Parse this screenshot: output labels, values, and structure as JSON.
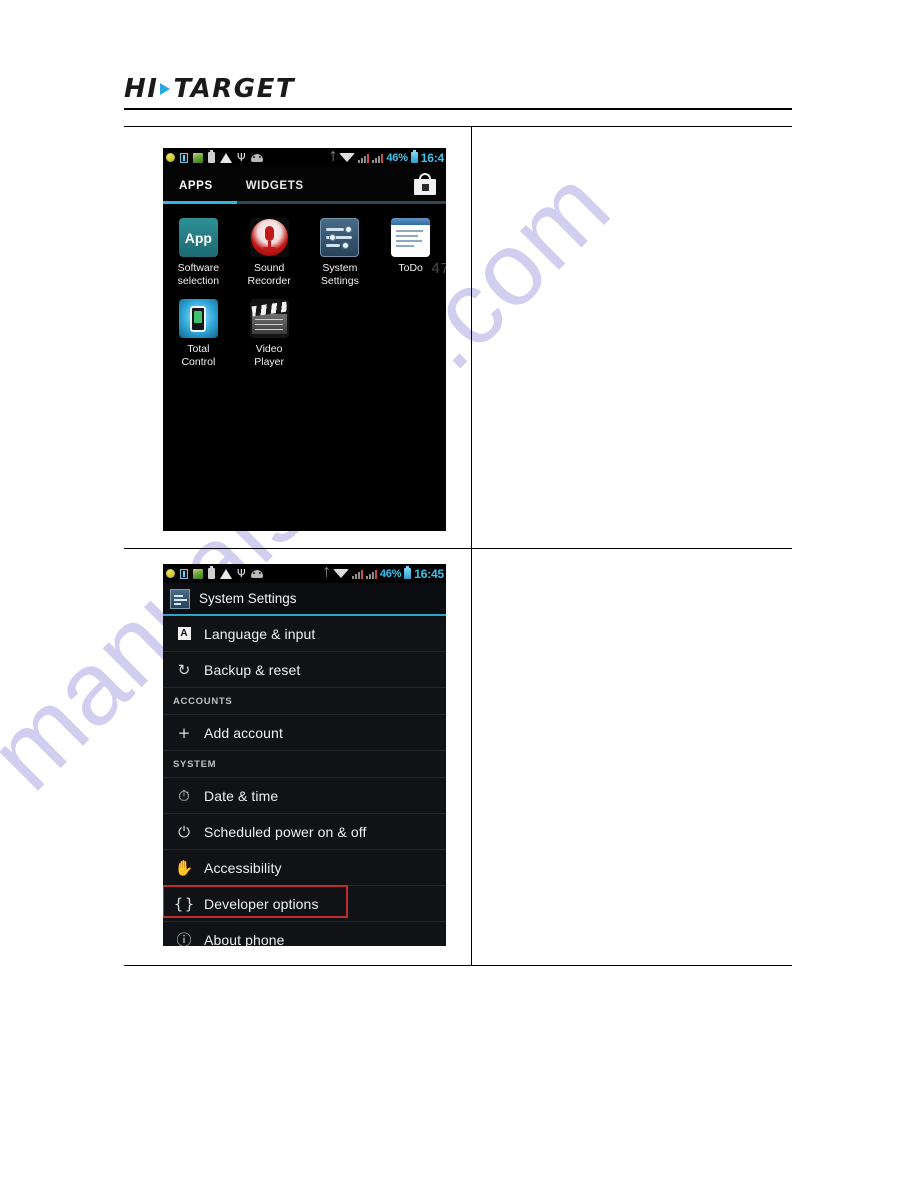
{
  "page": {
    "watermark": "manualshive.com",
    "corner_watermark": "47"
  },
  "header": {
    "logo_part1": "HI",
    "logo_part2": "TARGET",
    "triangle_color": "#2aa8e0"
  },
  "figures": [
    {
      "name": "app-drawer-screenshot",
      "statusbar": {
        "battery_percent": "46%",
        "time": "16:4",
        "icons_left": [
          "sync-icon",
          "sim-card-icon",
          "sd-card-icon",
          "battery-saver-icon",
          "warning-icon",
          "usb-icon",
          "android-robot-icon"
        ],
        "icons_right": [
          "bluetooth-icon",
          "wifi-icon",
          "signal-bars-icon",
          "signal-bars-2-icon",
          "battery-icon"
        ]
      },
      "tabs": [
        {
          "label": "APPS",
          "active": true
        },
        {
          "label": "WIDGETS",
          "active": false
        }
      ],
      "store_icon": "play-store-bag-icon",
      "apps": [
        {
          "label_line1": "Software",
          "label_line2": "selection",
          "icon": "app-selection-icon",
          "icon_text": "App"
        },
        {
          "label_line1": "Sound",
          "label_line2": "Recorder",
          "icon": "sound-recorder-icon"
        },
        {
          "label_line1": "System",
          "label_line2": "Settings",
          "icon": "system-settings-icon"
        },
        {
          "label_line1": "ToDo",
          "label_line2": "",
          "icon": "todo-icon"
        },
        {
          "label_line1": "Total",
          "label_line2": "Control",
          "icon": "total-control-icon"
        },
        {
          "label_line1": "Video",
          "label_line2": "Player",
          "icon": "video-player-icon"
        }
      ]
    },
    {
      "name": "system-settings-screenshot",
      "statusbar": {
        "battery_percent": "46%",
        "time": "16:45"
      },
      "title": "System Settings",
      "rows": [
        {
          "type": "item",
          "label": "Language & input",
          "icon": "language-input-icon",
          "highlighted": false
        },
        {
          "type": "item",
          "label": "Backup & reset",
          "icon": "backup-reset-icon",
          "highlighted": false
        },
        {
          "type": "section",
          "label": "ACCOUNTS"
        },
        {
          "type": "item",
          "label": "Add account",
          "icon": "add-account-icon",
          "highlighted": false
        },
        {
          "type": "section",
          "label": "SYSTEM"
        },
        {
          "type": "item",
          "label": "Date & time",
          "icon": "clock-icon",
          "highlighted": false
        },
        {
          "type": "item",
          "label": "Scheduled power on & off",
          "icon": "power-icon",
          "highlighted": false
        },
        {
          "type": "item",
          "label": "Accessibility",
          "icon": "hand-icon",
          "highlighted": false
        },
        {
          "type": "item",
          "label": "Developer options",
          "icon": "braces-icon",
          "highlighted": true
        },
        {
          "type": "item",
          "label": "About phone",
          "icon": "info-icon",
          "highlighted": false
        }
      ],
      "highlight_color": "#c02b2b"
    }
  ]
}
